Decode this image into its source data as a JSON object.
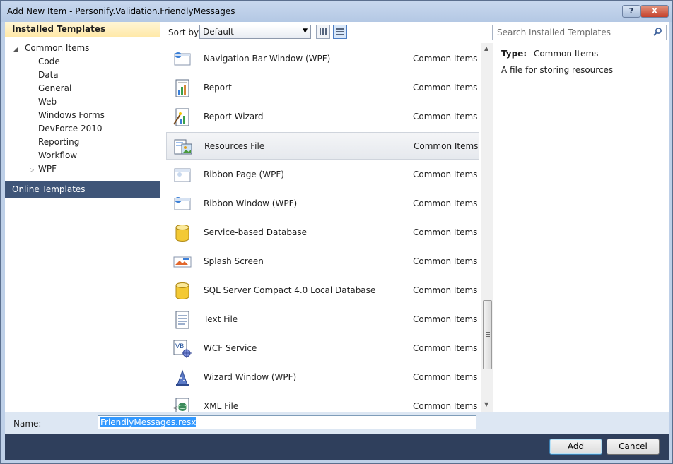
{
  "window": {
    "title": "Add New Item - Personify.Validation.FriendlyMessages",
    "help_glyph": "?",
    "close_glyph": "X"
  },
  "left": {
    "installed_title": "Installed Templates",
    "tree": [
      {
        "label": "Common Items",
        "level": 0,
        "expanded": true
      },
      {
        "label": "Code",
        "level": 1
      },
      {
        "label": "Data",
        "level": 1
      },
      {
        "label": "General",
        "level": 1
      },
      {
        "label": "Web",
        "level": 1
      },
      {
        "label": "Windows Forms",
        "level": 1
      },
      {
        "label": "DevForce 2010",
        "level": 1
      },
      {
        "label": "Reporting",
        "level": 1
      },
      {
        "label": "Workflow",
        "level": 1
      },
      {
        "label": "WPF",
        "level": 1,
        "collapsed": true
      }
    ],
    "online_title": "Online Templates"
  },
  "toolbar": {
    "sort_label": "Sort by:",
    "sort_value": "Default"
  },
  "templates": [
    {
      "name": "Navigation Bar Window (WPF)",
      "category": "Common Items",
      "icon": "wpf-window-icon"
    },
    {
      "name": "Report",
      "category": "Common Items",
      "icon": "report-icon"
    },
    {
      "name": "Report Wizard",
      "category": "Common Items",
      "icon": "report-wizard-icon"
    },
    {
      "name": "Resources File",
      "category": "Common Items",
      "icon": "resources-file-icon",
      "selected": true
    },
    {
      "name": "Ribbon Page (WPF)",
      "category": "Common Items",
      "icon": "ribbon-page-icon"
    },
    {
      "name": "Ribbon Window (WPF)",
      "category": "Common Items",
      "icon": "ribbon-window-icon"
    },
    {
      "name": "Service-based Database",
      "category": "Common Items",
      "icon": "database-icon"
    },
    {
      "name": "Splash Screen",
      "category": "Common Items",
      "icon": "splash-screen-icon"
    },
    {
      "name": "SQL Server Compact 4.0 Local Database",
      "category": "Common Items",
      "icon": "database-icon"
    },
    {
      "name": "Text File",
      "category": "Common Items",
      "icon": "text-file-icon"
    },
    {
      "name": "WCF Service",
      "category": "Common Items",
      "icon": "wcf-service-icon"
    },
    {
      "name": "Wizard Window (WPF)",
      "category": "Common Items",
      "icon": "wizard-window-icon"
    },
    {
      "name": "XML File",
      "category": "Common Items",
      "icon": "xml-file-icon"
    }
  ],
  "right": {
    "search_placeholder": "Search Installed Templates",
    "type_key": "Type:",
    "type_value": "Common Items",
    "description": "A file for storing resources"
  },
  "name_field": {
    "label": "Name:",
    "value": "FriendlyMessages.resx"
  },
  "buttons": {
    "add": "Add",
    "cancel": "Cancel"
  },
  "colors": {
    "accent": "#3f5578",
    "selection": "#3399ff",
    "installed_header": "#ffe8a6"
  }
}
